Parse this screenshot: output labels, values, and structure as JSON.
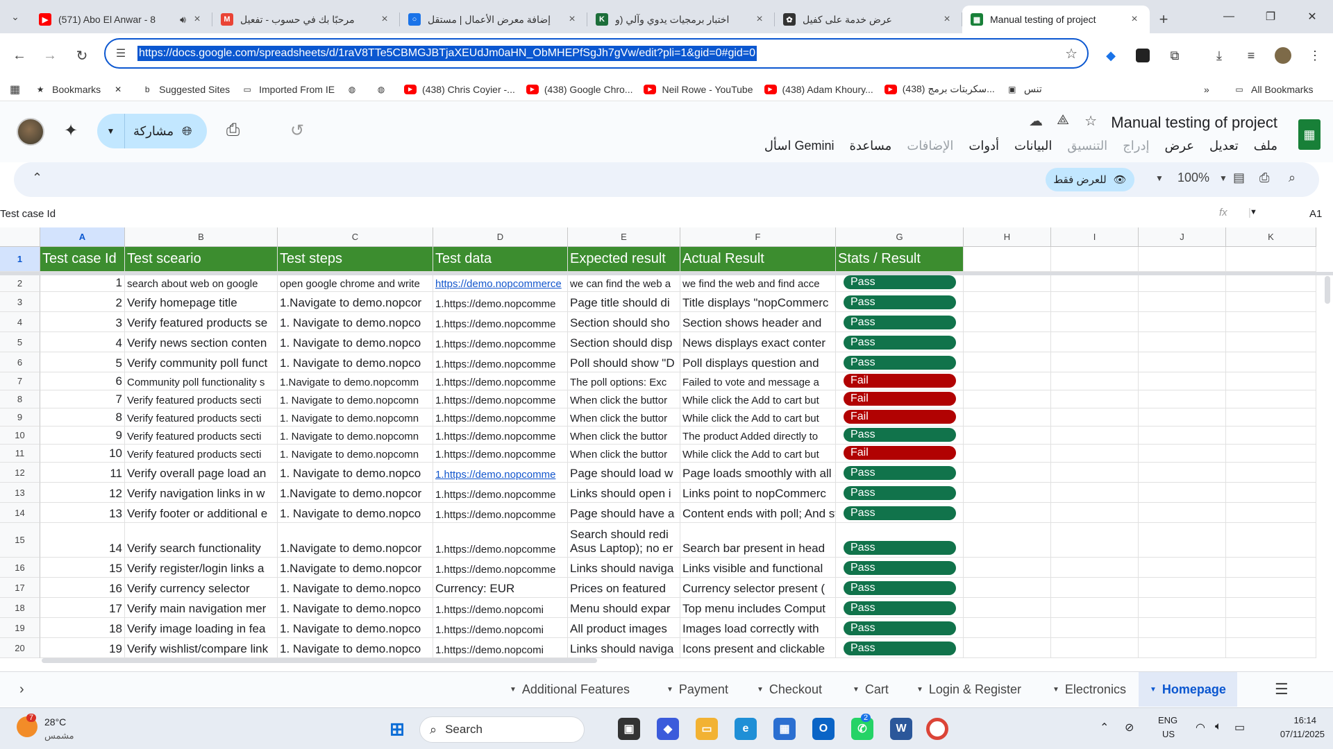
{
  "browser": {
    "tabs": [
      {
        "title": "(571) Abo El Anwar - 8",
        "color": "#ff0000",
        "glyph": "▶"
      },
      {
        "title": "مرحبًا بك في حسوب - تفعيل",
        "color": "#ea4335",
        "glyph": "M"
      },
      {
        "title": "إضافة معرض الأعمال | مستقل",
        "color": "#1a73e8",
        "glyph": "○"
      },
      {
        "title": "اختبار برمجيات يدوي وآلي (و",
        "color": "#1c6e3a",
        "glyph": "K"
      },
      {
        "title": "عرض خدمة على كفيل",
        "color": "#333333",
        "glyph": "✿"
      },
      {
        "title": "Manual testing of project",
        "color": "#188038",
        "glyph": "▦"
      }
    ],
    "url": "https://docs.google.com/spreadsheets/d/1raV8TTe5CBMGJBTjaXEUdJm0aHN_ObMHEPfSgJh7gVw/edit?pli=1&gid=0#gid=0",
    "bookmarks": [
      {
        "label": "Bookmarks",
        "icon": "star-icon"
      },
      {
        "label": "",
        "icon": "ai-logo-icon"
      },
      {
        "label": "Suggested Sites",
        "icon": "bing-icon"
      },
      {
        "label": "Imported From IE",
        "icon": "folder-icon"
      },
      {
        "label": "",
        "icon": "globe-icon"
      },
      {
        "label": "",
        "icon": "globe-icon"
      },
      {
        "label": "(438) Chris Coyier -...",
        "icon": "youtube-icon"
      },
      {
        "label": "(438) Google Chro...",
        "icon": "youtube-icon"
      },
      {
        "label": "Neil Rowe - YouTube",
        "icon": "youtube-icon"
      },
      {
        "label": "(438) Adam Khoury...",
        "icon": "youtube-icon"
      },
      {
        "label": "(438) سكربتات برمج...",
        "icon": "youtube-icon"
      },
      {
        "label": "تنس",
        "icon": "image-icon"
      }
    ],
    "all_bookmarks": "All Bookmarks"
  },
  "sheets": {
    "doc_title": "Manual testing of project",
    "menus": [
      "ملف",
      "تعديل",
      "عرض",
      "إدراج",
      "التنسيق",
      "البيانات",
      "أدوات",
      "الإضافات",
      "مساعدة",
      "اسأل Gemini"
    ],
    "share_label": "مشاركة",
    "view_only_label": "للعرض فقط",
    "zoom": "100%",
    "formula_value": "Test case Id",
    "cell_ref": "A1",
    "columns": [
      "A",
      "B",
      "C",
      "D",
      "E",
      "F",
      "G",
      "H",
      "I",
      "J",
      "K"
    ],
    "headers": [
      "Test case Id",
      "Test sceario",
      "Test steps",
      "Test data",
      "Expected result",
      "Actual Result",
      "Stats / Result"
    ],
    "rows": [
      {
        "row": "2",
        "id": "1",
        "scenario": "search about web on google",
        "steps": "open google chrome and write",
        "data": "https://demo.nopcommerce",
        "data_link": true,
        "expected": "we can find the web a",
        "actual": "we find the web and find acce",
        "status": "Pass"
      },
      {
        "row": "3",
        "id": "2",
        "scenario": "Verify homepage title",
        "steps": "1.Navigate to demo.nopcor",
        "data": "1.https://demo.nopcomme",
        "expected": "Page title should di",
        "actual": "Title displays \"nopCommerc",
        "status": "Pass"
      },
      {
        "row": "4",
        "id": "3",
        "scenario": "Verify featured products se",
        "steps": "1. Navigate to demo.nopco",
        "data": "1.https://demo.nopcomme",
        "expected": "Section should sho",
        "actual": "Section shows header and",
        "status": "Pass"
      },
      {
        "row": "5",
        "id": "4",
        "scenario": "Verify news section conten",
        "steps": "1. Navigate to demo.nopco",
        "data": "1.https://demo.nopcomme",
        "expected": "Section should disp",
        "actual": "News displays exact conter",
        "status": "Pass"
      },
      {
        "row": "6",
        "id": "5",
        "scenario": "Verify community poll funct",
        "steps": "1. Navigate to demo.nopco",
        "data": "1.https://demo.nopcomme",
        "expected": "Poll should show \"D",
        "actual": "Poll displays question and",
        "status": "Pass"
      },
      {
        "row": "7",
        "id": "6",
        "scenario": "Community poll functionality s",
        "steps": "1.Navigate to demo.nopcomm",
        "data": "1.https://demo.nopcomme",
        "expected": "The poll options: Exc",
        "actual": "Failed to vote and message a",
        "status": "Fail"
      },
      {
        "row": "8",
        "id": "7",
        "scenario": "Verify featured products secti",
        "steps": "1. Navigate to demo.nopcomn",
        "data": "1.https://demo.nopcomme",
        "expected": "When click the buttor",
        "actual": "While click the Add to cart but",
        "status": "Fail"
      },
      {
        "row": "9",
        "id": "8",
        "scenario": "Verify featured products secti",
        "steps": "1. Navigate to demo.nopcomn",
        "data": "1.https://demo.nopcomme",
        "expected": "When click the buttor",
        "actual": "While click the Add to cart but",
        "status": "Fail"
      },
      {
        "row": "10",
        "id": "9",
        "scenario": "Verify featured products secti",
        "steps": "1. Navigate to demo.nopcomn",
        "data": "1.https://demo.nopcomme",
        "expected": "When click the buttor",
        "actual": "The product Added directly to",
        "status": "Pass"
      },
      {
        "row": "11",
        "id": "10",
        "scenario": "Verify featured products secti",
        "steps": "1. Navigate to demo.nopcomn",
        "data": "1.https://demo.nopcomme",
        "expected": "When click the buttor",
        "actual": "While click the Add to cart but",
        "status": "Fail"
      },
      {
        "row": "12",
        "id": "11",
        "scenario": "Verify overall page load an",
        "steps": "1. Navigate to demo.nopco",
        "data": "1.https://demo.nopcomme",
        "data_link": true,
        "expected": "Page should load w",
        "actual": "Page loads smoothly with all s",
        "status": "Pass"
      },
      {
        "row": "13",
        "id": "12",
        "scenario": "Verify navigation links in w",
        "steps": "1.Navigate to demo.nopcor",
        "data": "1.https://demo.nopcomme",
        "expected": "Links should open i",
        "actual": "Links point to nopCommerc",
        "status": "Pass"
      },
      {
        "row": "14",
        "id": "13",
        "scenario": "Verify footer or additional e",
        "steps": "1. Navigate to demo.nopco",
        "data": "1.https://demo.nopcomme",
        "expected": "Page should have a",
        "actual": "Content ends with poll; And st",
        "status": "Pass"
      },
      {
        "row": "15",
        "id": "14",
        "scenario": "Verify search functionality",
        "steps": "1.Navigate to demo.nopcor",
        "data": "1.https://demo.nopcomme",
        "expected": "Search should redi",
        "expected2": "Asus Laptop); no er",
        "actual": "Search bar present in head",
        "status": "Pass"
      },
      {
        "row": "16",
        "id": "15",
        "scenario": "Verify register/login links a",
        "steps": "1.Navigate to demo.nopcor",
        "data": "1.https://demo.nopcomme",
        "expected": "Links should naviga",
        "actual": "Links visible and functional",
        "status": "Pass"
      },
      {
        "row": "17",
        "id": "16",
        "scenario": "Verify currency selector",
        "steps": "1. Navigate to demo.nopco",
        "data": "Currency: EUR",
        "expected": "Prices on featured",
        "actual": "Currency selector present (",
        "status": "Pass"
      },
      {
        "row": "18",
        "id": "17",
        "scenario": "Verify main navigation mer",
        "steps": "1. Navigate to demo.nopco",
        "data": "1.https://demo.nopcomi",
        "expected": "Menu should expar",
        "actual": "Top menu includes Comput",
        "status": "Pass"
      },
      {
        "row": "19",
        "id": "18",
        "scenario": "Verify image loading in fea",
        "steps": "1. Navigate to demo.nopco",
        "data": "1.https://demo.nopcomi",
        "expected": "All product images",
        "actual": "Images load correctly with",
        "status": "Pass"
      },
      {
        "row": "20",
        "id": "19",
        "scenario": "Verify wishlist/compare link",
        "steps": "1. Navigate to demo.nopco",
        "data": "1.https://demo.nopcomi",
        "expected": "Links should naviga",
        "actual": "Icons present and clickable",
        "status": "Pass"
      }
    ],
    "sheet_tabs": [
      "Additional Features",
      "Payment",
      "Checkout",
      "Cart",
      "Login & Register",
      "Electronics",
      "Homepage"
    ],
    "active_sheet": "Homepage",
    "status_colors": {
      "Pass": "#11734b",
      "Fail": "#b10202"
    },
    "header_color": "#3c8d2f"
  },
  "taskbar": {
    "weather_temp": "28°C",
    "weather_desc": "مشمس",
    "weather_badge": "7",
    "search_label": "Search",
    "whatsapp_badge": "2",
    "lang1": "ENG",
    "lang2": "US",
    "time": "16:14",
    "date": "07/11/2025"
  }
}
